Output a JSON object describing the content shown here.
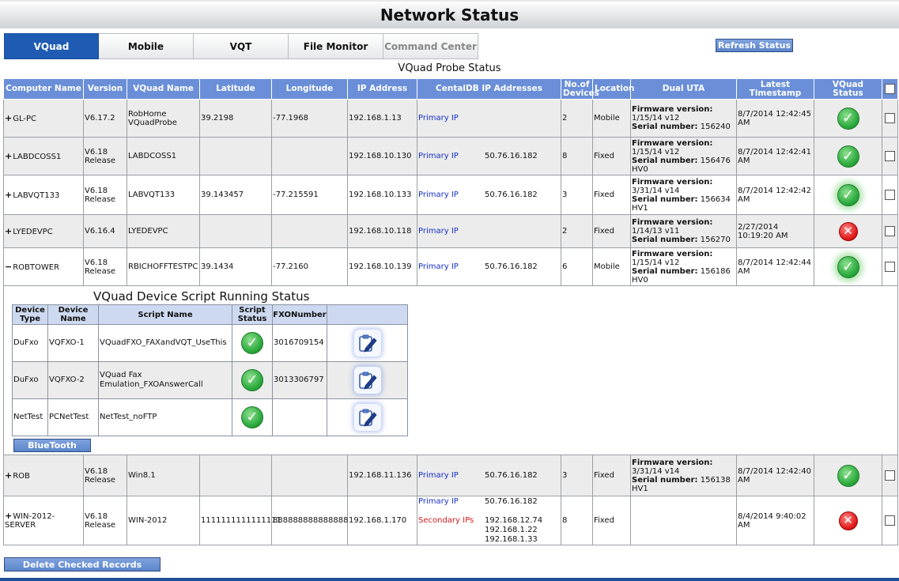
{
  "title": "Network Status",
  "tabs": [
    {
      "label": "VQuad"
    },
    {
      "label": "Mobile"
    },
    {
      "label": "VQT"
    },
    {
      "label": "File Monitor"
    },
    {
      "label": "Command Center"
    }
  ],
  "refresh_label": "Refresh Status",
  "probe_caption": "VQuad Probe Status",
  "columns": {
    "computer_name": "Computer Name",
    "version": "Version",
    "vquad_name": "VQuad Name",
    "latitude": "Latitude",
    "longitude": "Longitude",
    "ip_address": "IP Address",
    "centaldb": "CentalDB IP Addresses",
    "devices": "No.of Devices",
    "location": "Location",
    "dual_uta": "Dual UTA",
    "timestamp": "Latest Timestamp",
    "vquad_status": "VQuad Status"
  },
  "labels": {
    "primary_ip": "Primary IP",
    "secondary_ips": "Secondary IPs",
    "firmware": "Firmware version:",
    "serial": "Serial number:"
  },
  "rows": [
    {
      "expander": "+",
      "computer": "GL-PC",
      "version": "V6.17.2",
      "vquad_name": "RobHome VQuadProbe",
      "lat": "39.2198",
      "lon": "-77.1968",
      "ip": "192.168.1.13",
      "db_ip": "",
      "devices": "2",
      "location": "Mobile",
      "fw": "1/15/14 v12",
      "serial": "156240",
      "hv": "",
      "ts": "8/7/2014 12:42:45 AM",
      "status": "ok"
    },
    {
      "expander": "+",
      "computer": "LABDCOSS1",
      "version": "V6.18 Release",
      "vquad_name": "LABDCOSS1",
      "lat": "",
      "lon": "",
      "ip": "192.168.10.130",
      "db_ip": "50.76.16.182",
      "devices": "8",
      "location": "Fixed",
      "fw": "1/15/14 v12",
      "serial": "156476",
      "hv": "HV0",
      "ts": "8/7/2014 12:42:41 AM",
      "status": "ok"
    },
    {
      "expander": "+",
      "computer": "LABVQT133",
      "version": "V6.18 Release",
      "vquad_name": "LABVQT133",
      "lat": "39.143457",
      "lon": "-77.215591",
      "ip": "192.168.10.133",
      "db_ip": "50.76.16.182",
      "devices": "3",
      "location": "Fixed",
      "fw": "3/31/14 v14",
      "serial": "156634",
      "hv": "HV1",
      "ts": "8/7/2014 12:42:42 AM",
      "status": "ok"
    },
    {
      "expander": "+",
      "computer": "LYEDEVPC",
      "version": "V6.16.4",
      "vquad_name": "LYEDEVPC",
      "lat": "",
      "lon": "",
      "ip": "192.168.10.118",
      "db_ip": "",
      "devices": "2",
      "location": "Fixed",
      "fw": "1/14/13 v11",
      "serial": "156270",
      "hv": "",
      "ts": "2/27/2014 10:19:20 AM",
      "status": "bad"
    },
    {
      "expander": "−",
      "computer": "ROBTOWER",
      "version": "V6.18 Release",
      "vquad_name": "RBICHOFFTESTPC",
      "lat": "39.1434",
      "lon": "-77.2160",
      "ip": "192.168.10.139",
      "db_ip": "50.76.16.182",
      "devices": "6",
      "location": "Mobile",
      "fw": "1/15/14 v12",
      "serial": "156186",
      "hv": "HV0",
      "ts": "8/7/2014 12:42:44 AM",
      "status": "ok"
    },
    {
      "expander": "+",
      "computer": "ROB",
      "version": "V6.18 Release",
      "vquad_name": "Win8.1",
      "lat": "",
      "lon": "",
      "ip": "192.168.11.136",
      "db_ip": "50.76.16.182",
      "devices": "3",
      "location": "Fixed",
      "fw": "3/31/14 v14",
      "serial": "156138",
      "hv": "HV1",
      "ts": "8/7/2014 12:42:40 AM",
      "status": "ok"
    },
    {
      "expander": "+",
      "computer": "WIN-2012-SERVER",
      "version": "V6.18 Release",
      "vquad_name": "WIN-2012",
      "lat": "1111111111111111",
      "lon": "888888888888888",
      "ip": "192.168.1.170",
      "db_ip": "50.76.16.182",
      "secondary_ips": [
        "192.168.12.74",
        "192.168.1.22",
        "192.168.1.33"
      ],
      "devices": "8",
      "location": "Fixed",
      "fw": "",
      "serial": "",
      "hv": "",
      "ts": "8/4/2014 9:40:02 AM",
      "status": "bad"
    }
  ],
  "script_caption": "VQuad Device Script Running Status",
  "script_columns": {
    "device_type": "Device Type",
    "device_name": "Device Name",
    "script_name": "Script Name",
    "script_status": "Script Status",
    "fxo": "FXONumber"
  },
  "script_rows": [
    {
      "type": "DuFxo",
      "name": "VQFXO-1",
      "script": "VQuadFXO_FAXandVQT_UseThis",
      "fxo": "3016709154"
    },
    {
      "type": "DuFxo",
      "name": "VQFXO-2",
      "script": "VQuad Fax Emulation_FXOAnswerCall",
      "fxo": "3013306797"
    },
    {
      "type": "NetTest",
      "name": "PCNetTest",
      "script": "NetTest_noFTP",
      "fxo": ""
    }
  ],
  "bluetooth_label": "BlueTooth",
  "delete_label": "Delete Checked Records"
}
